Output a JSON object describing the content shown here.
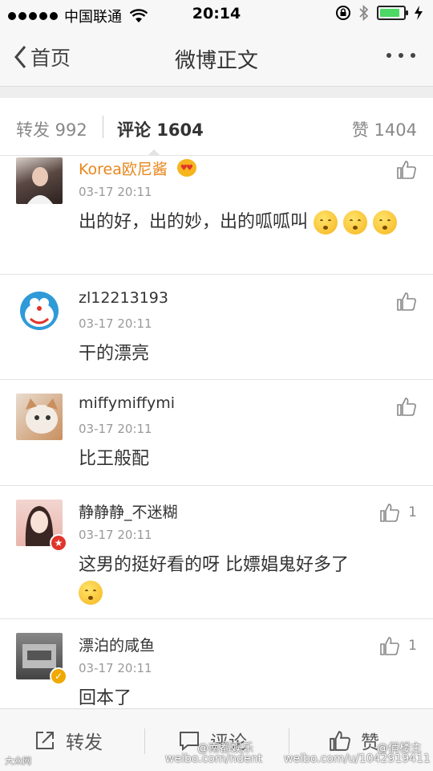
{
  "status_bar": {
    "carrier": "中国联通",
    "time": "20:14",
    "battery_level": 0.85
  },
  "nav": {
    "back_label": "首页",
    "title": "微博正文"
  },
  "counts": {
    "repost": "转发 992",
    "comment_label": "评论",
    "comment_count": "1604",
    "like": "赞 1404"
  },
  "comments": [
    {
      "username": "Korea欧尼酱",
      "time": "03-17 20:11",
      "text": "出的好，出的妙，出的呱呱叫",
      "likes": ""
    },
    {
      "username": "zl12213193",
      "time": "03-17 20:11",
      "text": "干的漂亮",
      "likes": ""
    },
    {
      "username": "miffymiffymi",
      "time": "03-17 20:11",
      "text": "比王般配",
      "likes": ""
    },
    {
      "username": "静静静_不迷糊",
      "time": "03-17 20:11",
      "text": "这男的挺好看的呀 比嫖娼鬼好多了",
      "likes": "1"
    },
    {
      "username": "漂泊的咸鱼",
      "time": "03-17 20:11",
      "text": "回本了",
      "likes": "1"
    }
  ],
  "toolbar": {
    "repost": "转发",
    "comment": "评论",
    "like": "赞"
  },
  "watermarks": {
    "left": "大众网",
    "center_name": "@南都娱乐",
    "center_url": "weibo.com/ndent",
    "right_name": "@俏楼主",
    "right_url": "weibo.com/u/1042919411"
  },
  "colors": {
    "accent_orange": "#e8861d",
    "battery_green": "#4cd964",
    "vip_red": "#e0352b",
    "verified_yellow": "#f0a900"
  }
}
